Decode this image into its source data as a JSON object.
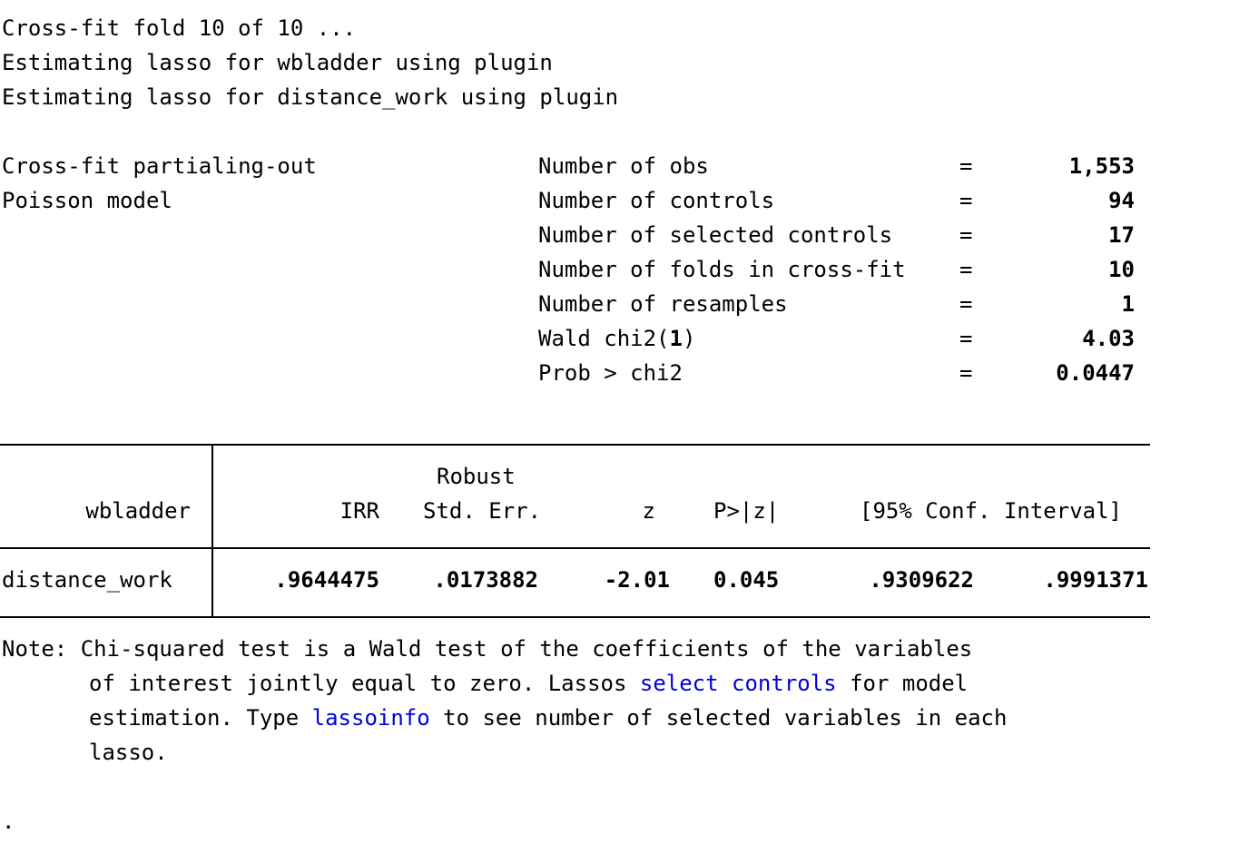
{
  "progress": {
    "line1": "Cross-fit fold 10 of 10 ...",
    "line2": "Estimating lasso for wbladder using plugin",
    "line3": "Estimating lasso for distance_work using plugin"
  },
  "model": {
    "method": "Cross-fit partialing-out",
    "type": "Poisson model"
  },
  "stats": {
    "obs_label": "Number of obs",
    "obs_value": "1,553",
    "controls_label": "Number of controls",
    "controls_value": "94",
    "selected_label": "Number of selected controls",
    "selected_value": "17",
    "folds_label": "Number of folds in cross-fit",
    "folds_value": "10",
    "resamples_label": "Number of resamples",
    "resamples_value": "1",
    "wald_label_pre": "Wald chi2(",
    "wald_df": "1",
    "wald_label_post": ")",
    "wald_value": "4.03",
    "prob_label": "Prob > chi2",
    "prob_value": "0.0447",
    "eq": "="
  },
  "table": {
    "depvar": "wbladder",
    "robust": "Robust",
    "col_irr": "IRR",
    "col_se": "Std. Err.",
    "col_z": "z",
    "col_p": "P>|z|",
    "col_ci": "[95% Conf. Interval]",
    "row": {
      "var": "distance_work",
      "irr": ".9644475",
      "se": ".0173882",
      "z": "-2.01",
      "p": "0.045",
      "ci_lo": ".9309622",
      "ci_hi": ".9991371"
    }
  },
  "note": {
    "prefix": "Note: ",
    "l1": "Chi-squared test is a Wald test of the coefficients of the variables",
    "l2a": "of interest jointly equal to zero. Lassos ",
    "l2_link": "select controls",
    "l2b": " for model",
    "l3a": "estimation. Type ",
    "l3_link": "lassoinfo",
    "l3b": " to see number of selected variables in each",
    "l4": "lasso."
  },
  "prompt": "."
}
